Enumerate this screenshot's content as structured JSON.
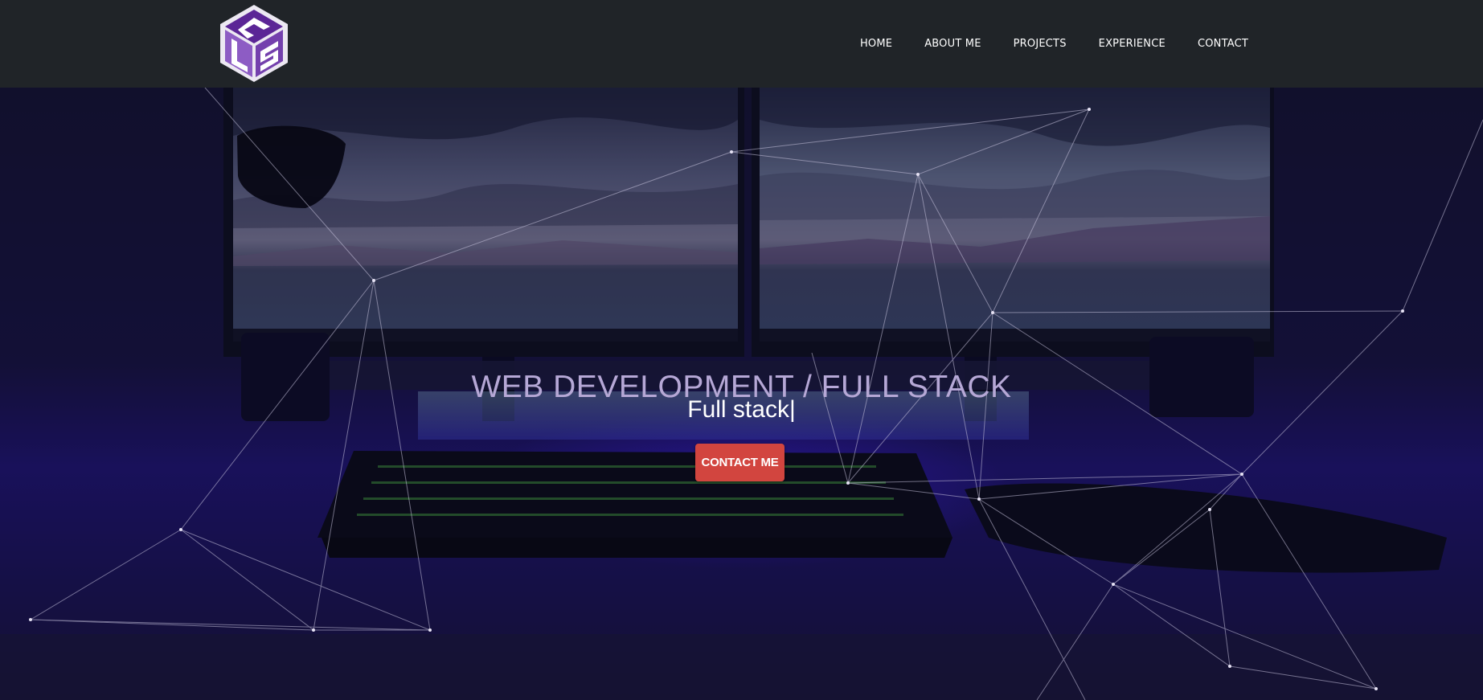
{
  "nav": {
    "logo_alt": "CS cube logo",
    "items": [
      {
        "label": "HOME"
      },
      {
        "label": "ABOUT ME"
      },
      {
        "label": "PROJECTS"
      },
      {
        "label": "EXPERIENCE"
      },
      {
        "label": "CONTACT"
      }
    ]
  },
  "hero": {
    "title": "WEB DEVELOPMENT / FULL STACK",
    "typed_text": "Full stack",
    "cursor": "|",
    "cta_label": "CONTACT ME",
    "background_icon": "desk-setup-photo",
    "overlay_icon": "particle-network"
  },
  "colors": {
    "navbar": "#202428",
    "cta": "#d2453f",
    "title": "#b6a8d6",
    "logo_purple": "#6a2fa8"
  }
}
